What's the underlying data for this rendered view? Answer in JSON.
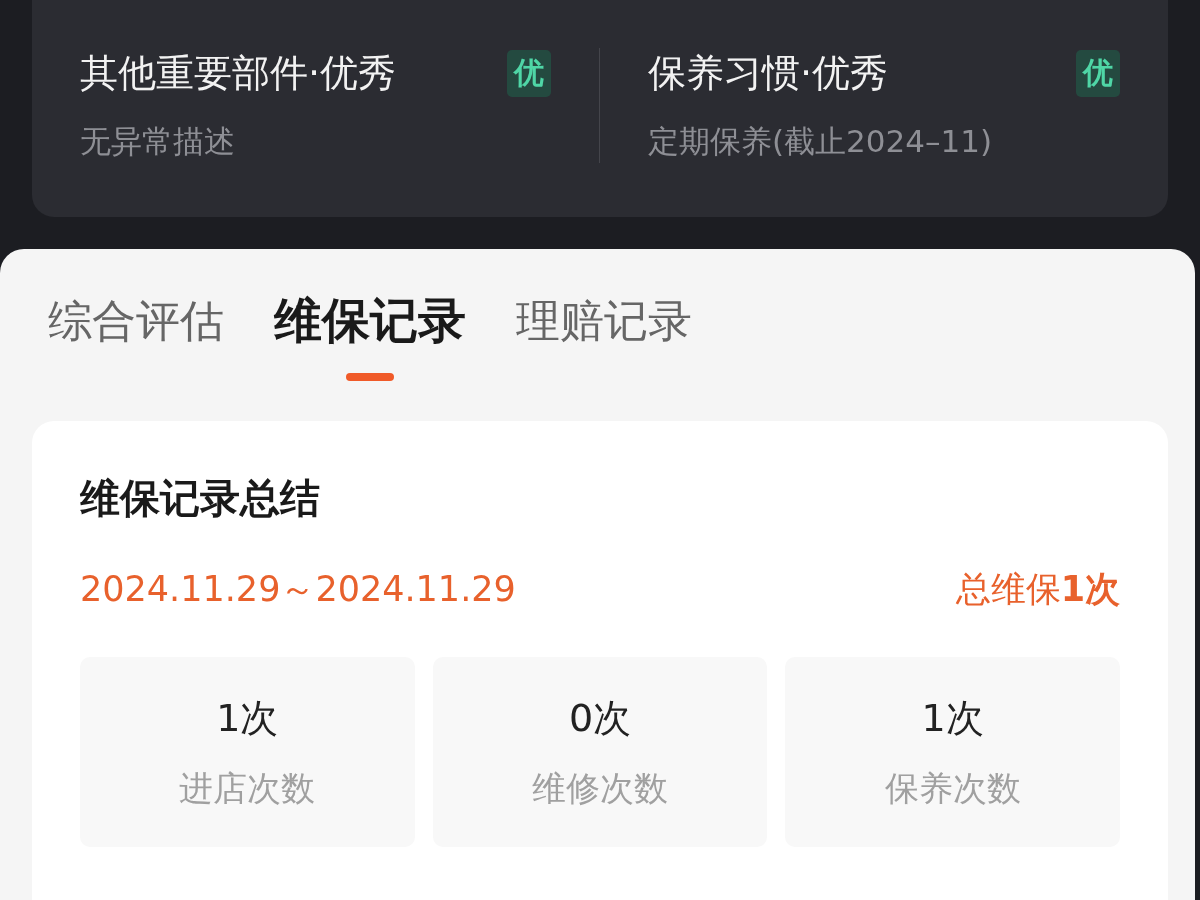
{
  "assessment_items": [
    {
      "title": "其他重要部件·优秀",
      "grade": "优",
      "description": "无异常描述"
    },
    {
      "title": "保养习惯·优秀",
      "grade": "优",
      "description": "定期保养(截止2024–11)"
    }
  ],
  "tabs": [
    {
      "label": "综合评估",
      "selected": false
    },
    {
      "label": "维保记录",
      "selected": true
    },
    {
      "label": "理赔记录",
      "selected": false
    }
  ],
  "summary": {
    "title": "维保记录总结",
    "date_range": "2024.11.29～2024.11.29",
    "total": "总维保**1次**",
    "stats": [
      {
        "value": "1次",
        "label": "进店次数"
      },
      {
        "value": "0次",
        "label": "维修次数"
      },
      {
        "value": "1次",
        "label": "保养次数"
      }
    ]
  }
}
